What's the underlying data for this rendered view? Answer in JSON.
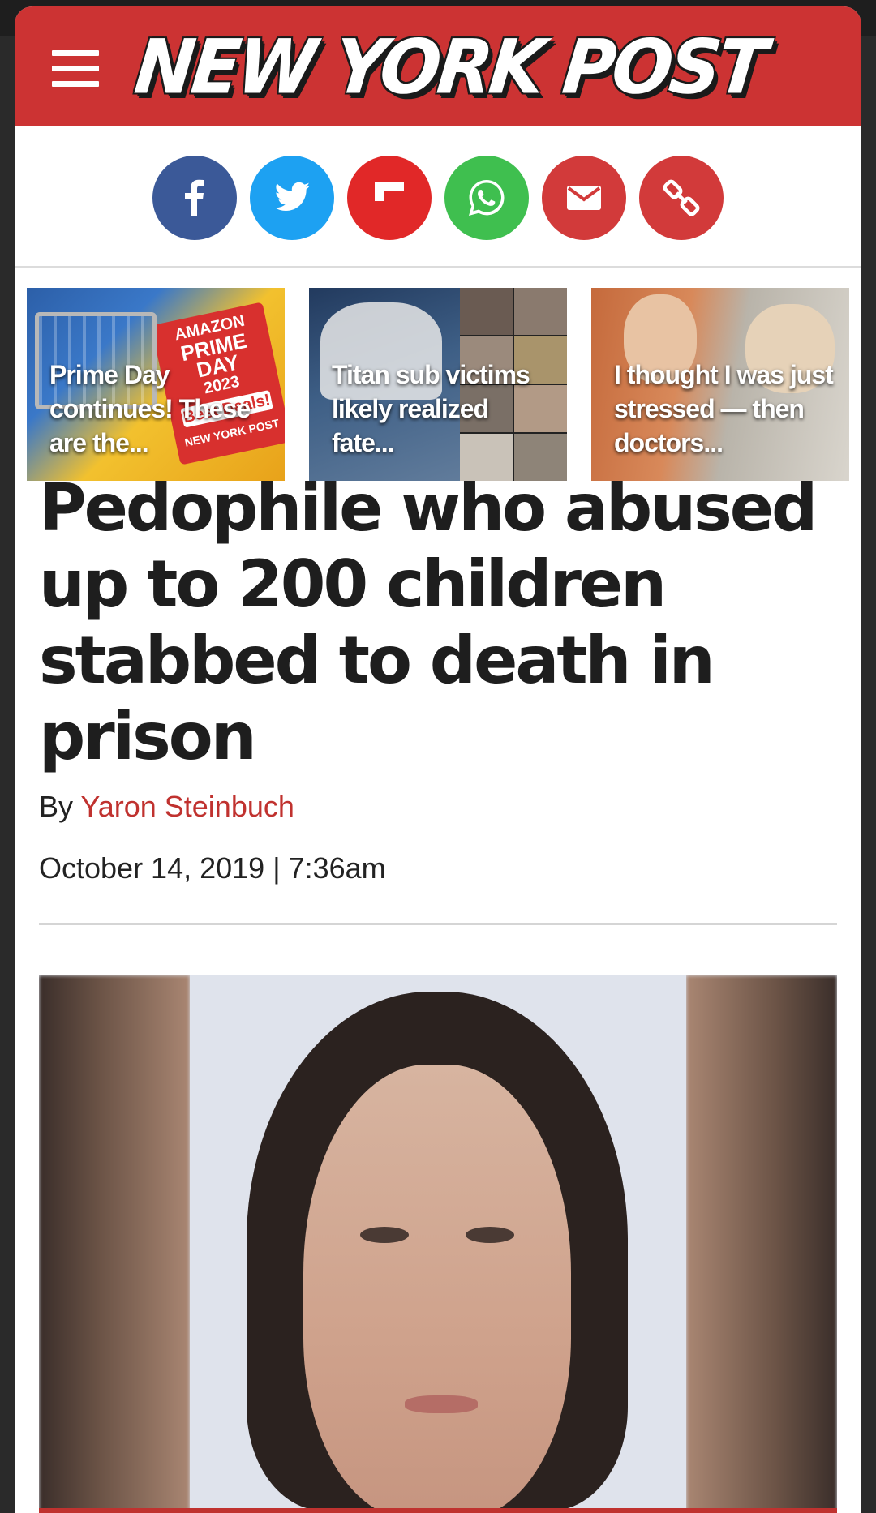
{
  "header": {
    "logo_text": "NEW YORK POST",
    "brand_color": "#cc3333"
  },
  "share": [
    {
      "name": "facebook",
      "icon": "facebook-icon",
      "color": "#3b5998"
    },
    {
      "name": "twitter",
      "icon": "twitter-icon",
      "color": "#1da1f2"
    },
    {
      "name": "flipboard",
      "icon": "flipboard-icon",
      "color": "#e12828"
    },
    {
      "name": "whatsapp",
      "icon": "whatsapp-icon",
      "color": "#3fbf4f"
    },
    {
      "name": "email",
      "icon": "email-icon",
      "color": "#d23a3a"
    },
    {
      "name": "copy-link",
      "icon": "link-icon",
      "color": "#d23a3a"
    }
  ],
  "trending": [
    {
      "label": "Prime Day continues! These are the...",
      "badge_lines": [
        "AMAZON",
        "PRIME",
        "DAY",
        "2023",
        "Best Deals!",
        "NEW YORK POST"
      ]
    },
    {
      "label": "Titan sub victims likely realized fate..."
    },
    {
      "label": "I thought I was just stressed — then doctors..."
    }
  ],
  "article": {
    "headline": "Pedophile who abused up to 200 children stabbed to death in prison",
    "byline_prefix": "By",
    "author": "Yaron Steinbuch",
    "date": "October 14, 2019 | 7:36am"
  }
}
